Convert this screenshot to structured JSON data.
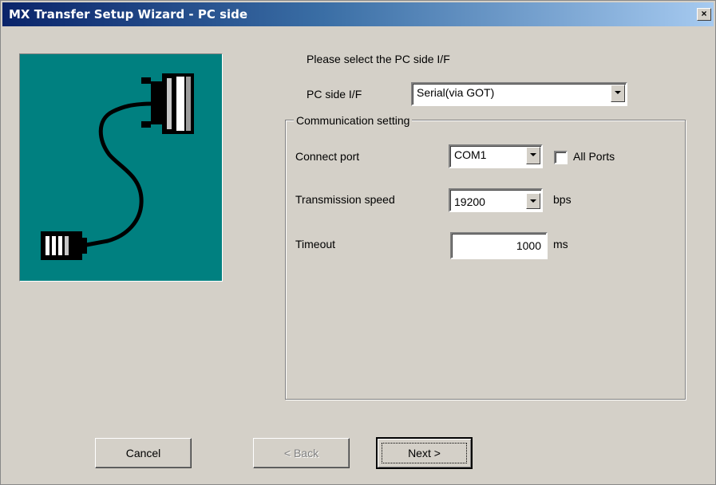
{
  "window": {
    "title": "MX Transfer Setup Wizard - PC side",
    "close_label": "×"
  },
  "illustration": {
    "description_icon": "serial-cable-icon",
    "bg_color": "#008080"
  },
  "pc_side": {
    "prompt": "Please select the PC side I/F",
    "label": "PC side I/F",
    "value": "Serial(via GOT)"
  },
  "communication": {
    "group_title": "Communication setting",
    "connect_port": {
      "label": "Connect port",
      "value": "COM1",
      "all_ports_label": "All Ports",
      "all_ports_checked": false
    },
    "speed": {
      "label": "Transmission speed",
      "value": "19200",
      "unit": "bps"
    },
    "timeout": {
      "label": "Timeout",
      "value": "1000",
      "unit": "ms"
    }
  },
  "buttons": {
    "cancel": "Cancel",
    "back": "< Back",
    "next": "Next >"
  }
}
